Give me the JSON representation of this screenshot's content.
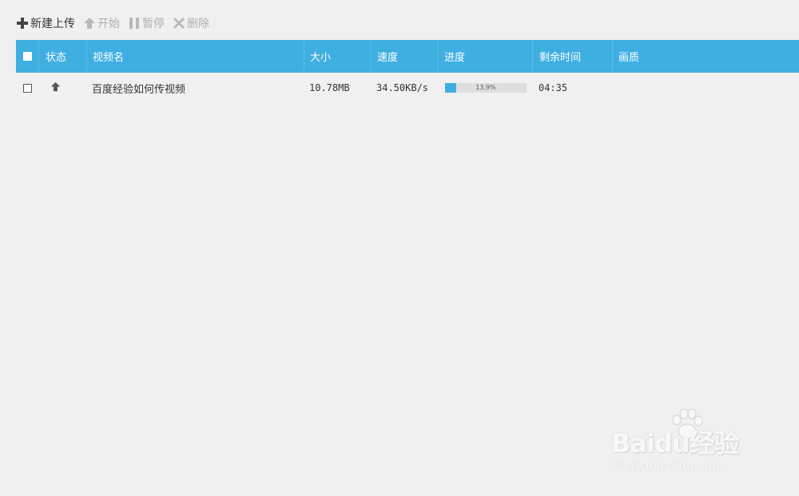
{
  "toolbar": {
    "new_upload": "新建上传",
    "start": "开始",
    "pause": "暂停",
    "delete": "删除"
  },
  "table": {
    "columns": [
      "状态",
      "视频名",
      "大小",
      "速度",
      "进度",
      "剩余时间",
      "画质"
    ],
    "rows": [
      {
        "status_icon": "upload-arrow-icon",
        "name": "百度经验如何传视频",
        "size": "10.78MB",
        "speed": "34.50KB/s",
        "progress_percent": 13.9,
        "progress_label": "13.9%",
        "remaining": "04:35",
        "quality": ""
      }
    ]
  },
  "watermark": {
    "brand": "Baidu经验",
    "url": "jingyan.baidu.com"
  },
  "colors": {
    "accent": "#3fafe2",
    "background": "#f0f0f0",
    "disabled_text": "#b0b0b0"
  }
}
